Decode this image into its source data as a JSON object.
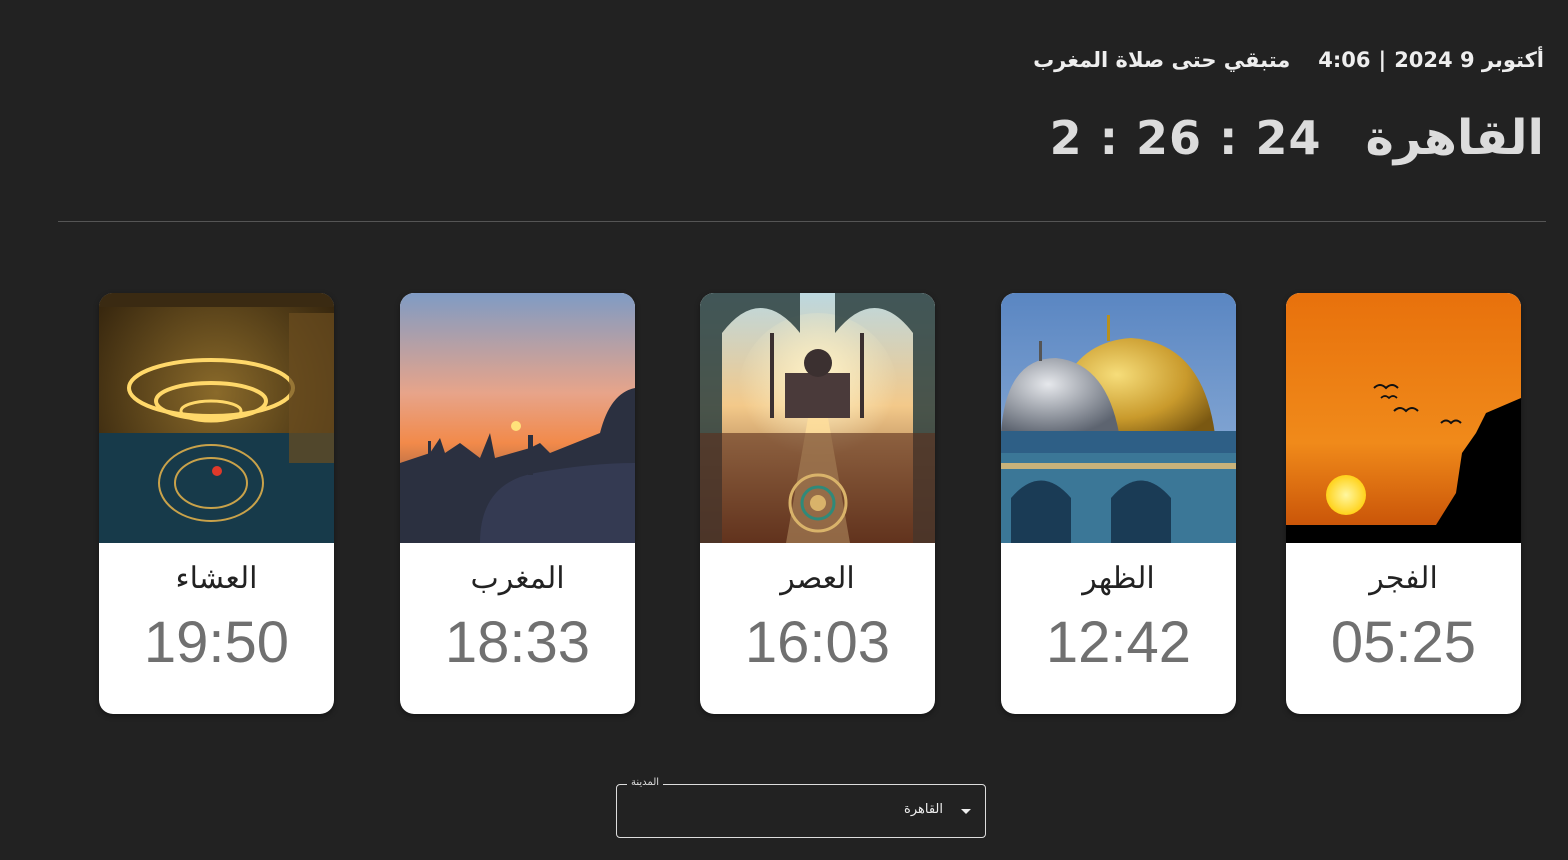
{
  "header": {
    "date": "أكتوبر 9 2024",
    "current_time": "4:06",
    "separator": "|",
    "remaining_label": "متبقي حتى صلاة المغرب"
  },
  "main": {
    "city": "القاهرة",
    "countdown": "2 : 26 : 24"
  },
  "prayers": [
    {
      "name": "الفجر",
      "time": "05:25",
      "image": "sunrise-birds-image"
    },
    {
      "name": "الظهر",
      "time": "12:42",
      "image": "dome-of-rock-image"
    },
    {
      "name": "العصر",
      "time": "16:03",
      "image": "ornate-mosque-arches-image"
    },
    {
      "name": "المغرب",
      "time": "18:33",
      "image": "sunset-city-skyline-image"
    },
    {
      "name": "العشاء",
      "time": "19:50",
      "image": "mosque-chandelier-interior-image"
    }
  ],
  "city_select": {
    "label": "المدينة",
    "value": "القاهرة",
    "icon": "caret-down-icon"
  },
  "colors": {
    "background": "#222222",
    "card": "#ffffff",
    "time_text": "#707070"
  }
}
